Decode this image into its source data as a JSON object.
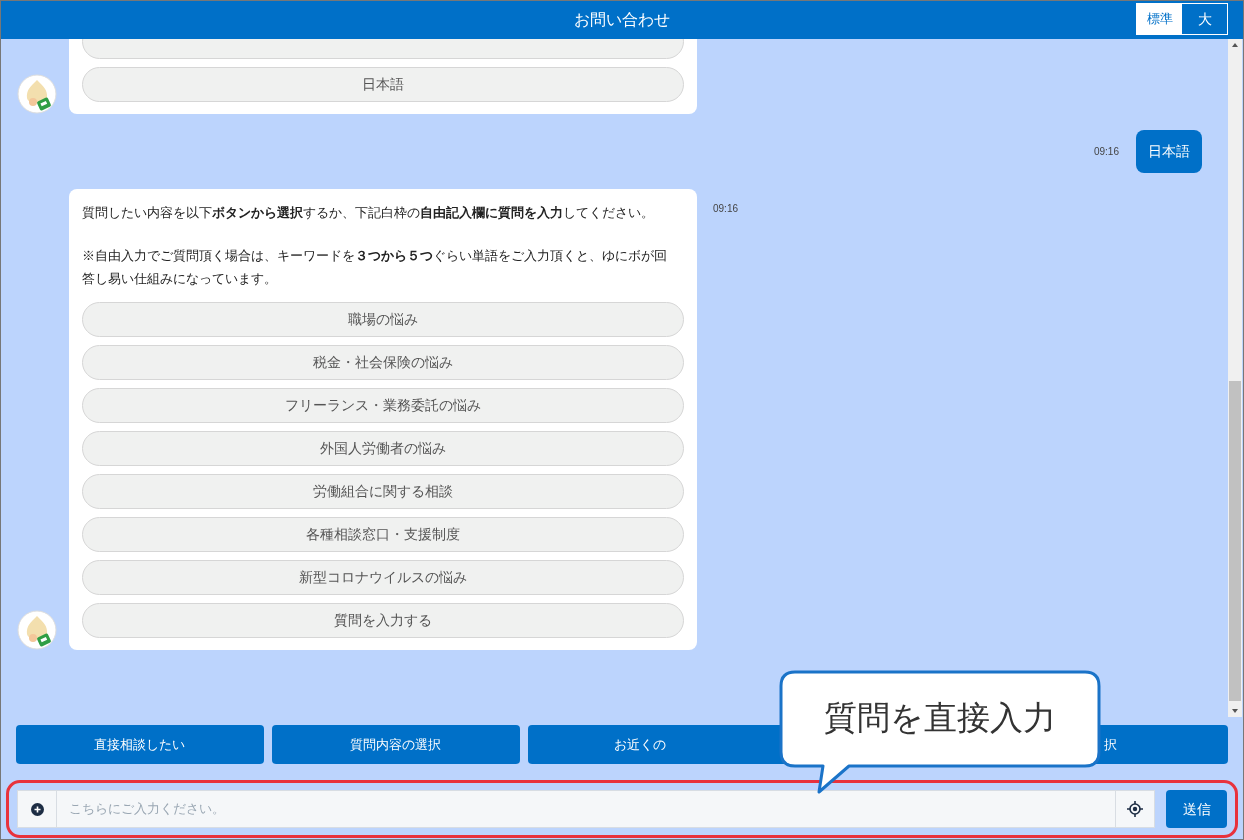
{
  "header": {
    "title": "お問い合わせ",
    "font_sizes": [
      {
        "label": "標準",
        "selected": true
      },
      {
        "label": "大",
        "selected": false
      }
    ]
  },
  "messages": [
    {
      "kind": "bot",
      "cut_option_above": true,
      "options": [
        "日本語"
      ]
    },
    {
      "kind": "user",
      "text": "日本語",
      "time": "09:16"
    },
    {
      "kind": "bot",
      "time": "09:16",
      "paragraphs": [
        "質問したい内容を以下**ボタンから選択**するか、下記白枠の**自由記入欄に質問を入力**してください。",
        "※自由入力でご質問頂く場合は、キーワードを**３つから５つ**ぐらい単語をご入力頂くと、ゆにボが回答し易い仕組みになっています。"
      ],
      "options": [
        "職場の悩み",
        "税金・社会保険の悩み",
        "フリーランス・業務委託の悩み",
        "外国人労働者の悩み",
        "労働組合に関する相談",
        "各種相談窓口・支援制度",
        "新型コロナウイルスの悩み",
        "質問を入力する"
      ]
    }
  ],
  "quick_buttons": [
    {
      "label": "直接相談したい",
      "kind": "full"
    },
    {
      "label": "質問内容の選択",
      "kind": "full"
    },
    {
      "label": "お近くの",
      "kind": "tail_hidden"
    },
    {
      "label": "択",
      "kind": "head_hidden"
    }
  ],
  "input": {
    "placeholder": "こちらにご入力ください。",
    "send_label": "送信"
  },
  "callout": {
    "text": "質問を直接入力"
  }
}
